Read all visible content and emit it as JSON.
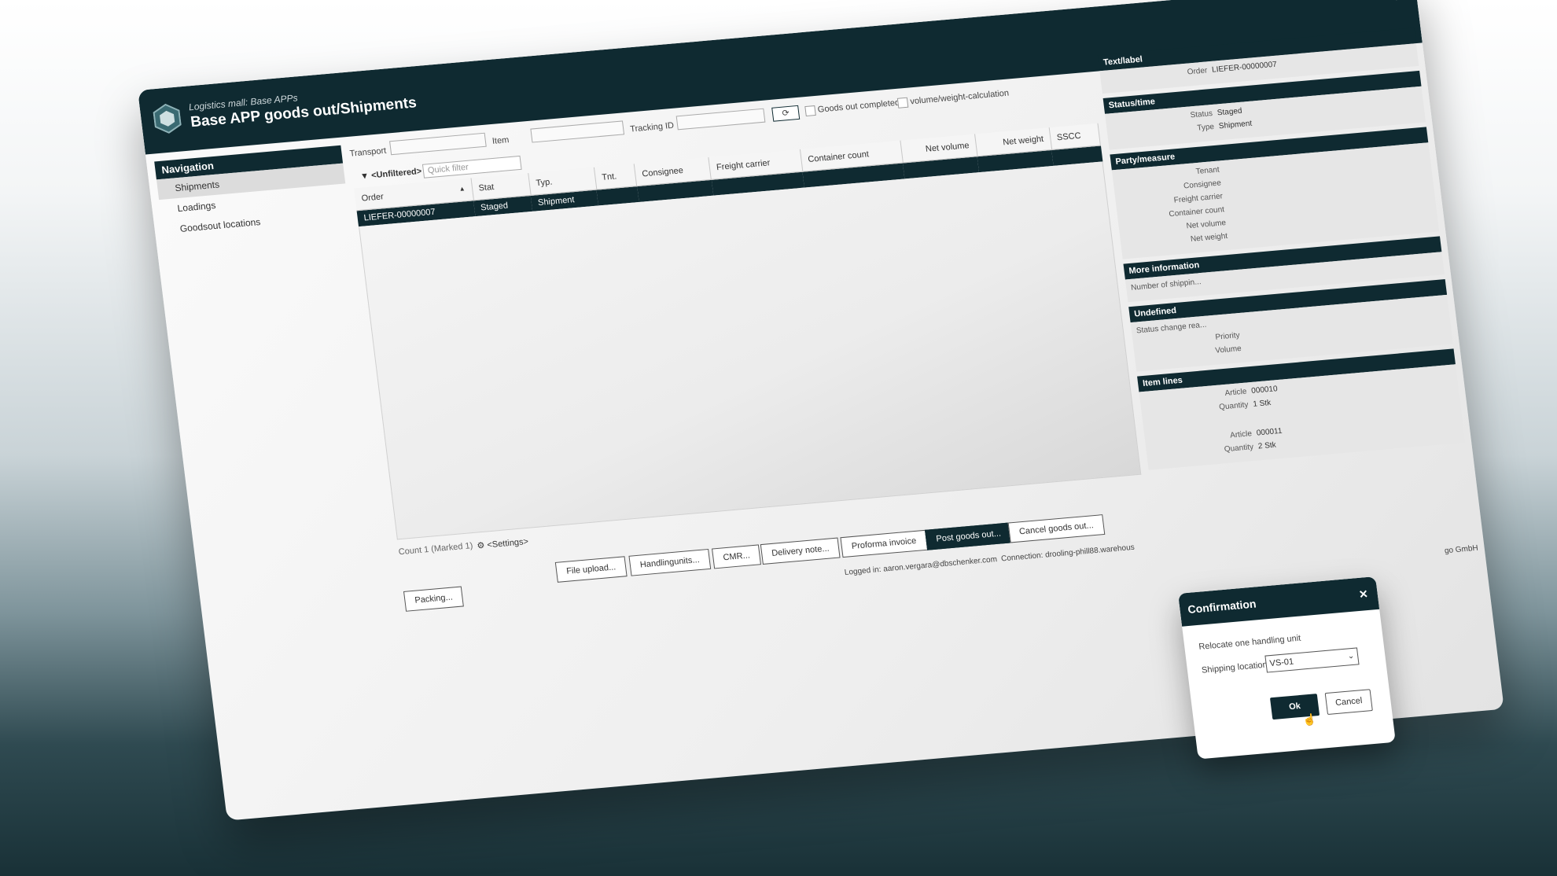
{
  "header": {
    "subtitle": "Logistics mall: Base APPs",
    "title": "Base APP goods out/Shipments",
    "menu_icon": "≡"
  },
  "sidebar": {
    "heading": "Navigation",
    "items": [
      {
        "label": "Shipments",
        "active": true
      },
      {
        "label": "Loadings",
        "active": false
      },
      {
        "label": "Goodsout locations",
        "active": false
      }
    ]
  },
  "filters": {
    "transport_label": "Transport",
    "transport_value": "",
    "item_label": "Item",
    "item_value": "",
    "tracking_label": "Tracking ID",
    "tracking_value": "",
    "refresh_icon": "⟳",
    "goods_out_completed_label": "Goods out completed",
    "goods_out_completed_checked": false,
    "volume_weight_label": "volume/weight-calculation",
    "volume_weight_checked": false,
    "filter_tag": "<Unfiltered>",
    "quick_filter_placeholder": "Quick filter"
  },
  "table": {
    "columns": [
      "Order",
      "Stat",
      "Typ.",
      "Tnt.",
      "Consignee",
      "Freight carrier",
      "Container count",
      "Net volume",
      "Net weight",
      "SSCC"
    ],
    "sort_icon": "▲",
    "rows": [
      {
        "order": "LIEFER-00000007",
        "stat": "Staged",
        "typ": "Shipment",
        "tnt": "",
        "consignee": "",
        "carrier": "",
        "container": "",
        "net_volume": "",
        "net_weight": "",
        "sscc": ""
      }
    ]
  },
  "footer": {
    "count_text": "Count 1 (Marked 1)",
    "settings_label": "<Settings>",
    "buttons": {
      "packing": "Packing...",
      "file_upload": "File upload...",
      "handlingunits": "Handlingunits...",
      "cmr": "CMR...",
      "delivery_note": "Delivery note...",
      "proforma_invoice": "Proforma invoice",
      "post_goods_out": "Post goods out...",
      "cancel_goods_out": "Cancel goods out..."
    },
    "logged_in": "Logged in: aaron.vergara@dbschenker.com",
    "connection": "Connection: drooling-phill88.warehous",
    "company_fragment": "go GmbH"
  },
  "details": {
    "text_label": {
      "heading": "Text/label",
      "order_label": "Order",
      "order_value": "LIEFER-00000007"
    },
    "status_time": {
      "heading": "Status/time",
      "status_label": "Status",
      "status_value": "Staged",
      "type_label": "Type",
      "type_value": "Shipment"
    },
    "party_measure": {
      "heading": "Party/measure",
      "labels": [
        "Tenant",
        "Consignee",
        "Freight carrier",
        "Container count",
        "Net volume",
        "Net weight"
      ]
    },
    "more_info": {
      "heading": "More information",
      "text": "Number of shippin..."
    },
    "undefined": {
      "heading": "Undefined",
      "text": "Status change rea...",
      "priority_label": "Priority",
      "volume_label": "Volume"
    },
    "item_lines": {
      "heading": "Item lines",
      "lines": [
        {
          "article_label": "Article",
          "article": "000010",
          "quantity_label": "Quantity",
          "quantity": "1 Stk"
        },
        {
          "article_label": "Article",
          "article": "000011",
          "quantity_label": "Quantity",
          "quantity": "2 Stk"
        }
      ]
    }
  },
  "dialog": {
    "title": "Confirmation",
    "close_icon": "✕",
    "message": "Relocate one handling unit",
    "shipping_location_label": "Shipping location:",
    "shipping_location_value": "VS-01",
    "ok_label": "Ok",
    "cancel_label": "Cancel"
  },
  "colors": {
    "dark_teal": "#0f2a31",
    "background": "#ececec"
  }
}
